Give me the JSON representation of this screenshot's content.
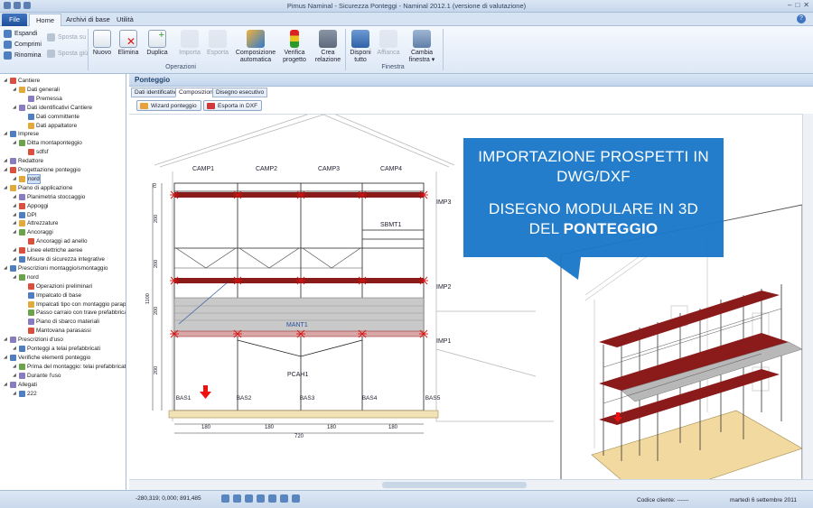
{
  "window": {
    "title": "Pimus Naminal - Sicurezza Ponteggi - Naminal 2012.1 (versione di valutazione)"
  },
  "tabs": [
    "File",
    "Home",
    "Archivi di base",
    "Utilità"
  ],
  "ribbon": {
    "left_small": [
      "Espandi",
      "Comprimi",
      "Rinomina"
    ],
    "move_small": [
      "Sposta su",
      "Sposta giù"
    ],
    "buttons": [
      "Nuovo",
      "Elimina",
      "Duplica",
      "Importa",
      "Esporta",
      "Composizione automatica",
      "Verifica progetto",
      "Crea relazione",
      "Disponi tutto",
      "Affianca",
      "Cambia finestra"
    ],
    "groups": [
      "Operazioni",
      "Finestra"
    ]
  },
  "tree": [
    {
      "label": "Cantiere",
      "level": 0
    },
    {
      "label": "Dati generali",
      "level": 1
    },
    {
      "label": "Premessa",
      "level": 2
    },
    {
      "label": "Dati identificativi Cantiere",
      "level": 1
    },
    {
      "label": "Dati committente",
      "level": 2
    },
    {
      "label": "Dati appaltatore",
      "level": 2
    },
    {
      "label": "Imprese",
      "level": 0
    },
    {
      "label": "Ditta montaponteggio",
      "level": 1
    },
    {
      "label": "sdfsf",
      "level": 2
    },
    {
      "label": "Redattore",
      "level": 0
    },
    {
      "label": "Progettazione ponteggio",
      "level": 0
    },
    {
      "label": "nord",
      "level": 1,
      "selected": true
    },
    {
      "label": "Piano di applicazione",
      "level": 0
    },
    {
      "label": "Planimetria stoccaggio",
      "level": 1
    },
    {
      "label": "Appoggi",
      "level": 1
    },
    {
      "label": "DPI",
      "level": 1
    },
    {
      "label": "Attrezzature",
      "level": 1
    },
    {
      "label": "Ancoraggi",
      "level": 1
    },
    {
      "label": "Ancoraggi ad anello",
      "level": 2
    },
    {
      "label": "Linee elettriche aeree",
      "level": 1
    },
    {
      "label": "Misure di sicurezza integrative",
      "level": 1
    },
    {
      "label": "Prescrizioni montaggio/smontaggio",
      "level": 0
    },
    {
      "label": "nord",
      "level": 1
    },
    {
      "label": "Operazioni preliminari",
      "level": 2
    },
    {
      "label": "Impalcato di base",
      "level": 2
    },
    {
      "label": "Impalcati tipo con montaggio parapetti",
      "level": 2
    },
    {
      "label": "Passo carraio con trave prefabbricata",
      "level": 2
    },
    {
      "label": "Piano di sbarco materiali",
      "level": 2
    },
    {
      "label": "Mantovana parasassi",
      "level": 2
    },
    {
      "label": "Prescrizioni d'uso",
      "level": 0
    },
    {
      "label": "Ponteggi a telai prefabbricati",
      "level": 1
    },
    {
      "label": "Verifiche elementi ponteggio",
      "level": 0
    },
    {
      "label": "Prima del montaggio: telai prefabbricati",
      "level": 1
    },
    {
      "label": "Durante l'uso",
      "level": 1
    },
    {
      "label": "Allegati",
      "level": 0
    },
    {
      "label": "222",
      "level": 1
    }
  ],
  "panel": {
    "title": "Ponteggio",
    "subtabs": [
      "Dati identificativi",
      "Composizione",
      "Disegno esecutivo"
    ],
    "toolbar": [
      "Wizard ponteggio",
      "Esporta in DXF"
    ]
  },
  "drawing": {
    "campate": [
      "CAMP1",
      "CAMP2",
      "CAMP3",
      "CAMP4"
    ],
    "impalcati": [
      "IMP3",
      "IMP2",
      "IMP1"
    ],
    "labels": {
      "sbmt": "SBMT1",
      "mant": "MANT1",
      "pcah": "PCAH1"
    },
    "basi": [
      "BAS1",
      "BAS2",
      "BAS3",
      "BAS4",
      "BAS5"
    ],
    "bottom_dims": [
      "180",
      "180",
      "180",
      "180"
    ],
    "total_dim": "720",
    "left_dims": [
      "70",
      "200",
      "200",
      "200",
      "200"
    ],
    "total_height": "1100"
  },
  "callout": {
    "line1": "IMPORTAZIONE PROSPETTI IN",
    "line2": "DWG/DXF",
    "line3": "DISEGNO MODULARE IN 3D",
    "line4_normal": "DEL ",
    "line4_bold": "PONTEGGIO"
  },
  "status": {
    "coords": "-280,319; 0,000; 891,485",
    "client": "Codice cliente: ------",
    "date": "martedì 6 settembre 2011"
  },
  "colors": {
    "accent": "#1f5fae",
    "callout": "#1877c9",
    "deck": "#8b1a1a",
    "anchor": "#d11"
  }
}
